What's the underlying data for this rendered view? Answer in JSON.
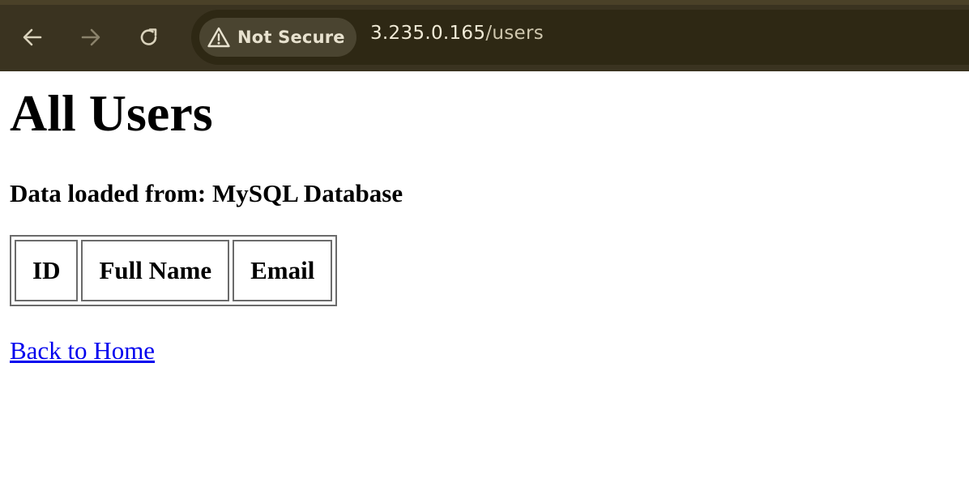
{
  "browser": {
    "security_label": "Not Secure",
    "url_host": "3.235.0.165",
    "url_path": "/users",
    "icons": {
      "back": "arrow-left-icon",
      "forward": "arrow-right-icon",
      "reload": "reload-icon",
      "security": "warning-triangle-icon"
    },
    "colors": {
      "toolbar": "#3a3320",
      "omnibox": "#2e2814",
      "chip": "#4a4430"
    }
  },
  "page": {
    "title": "All Users",
    "source_line": "Data loaded from: MySQL Database",
    "table": {
      "headers": [
        "ID",
        "Full Name",
        "Email"
      ],
      "rows": []
    },
    "home_link": "Back to Home",
    "link_color": "#0000ee"
  }
}
